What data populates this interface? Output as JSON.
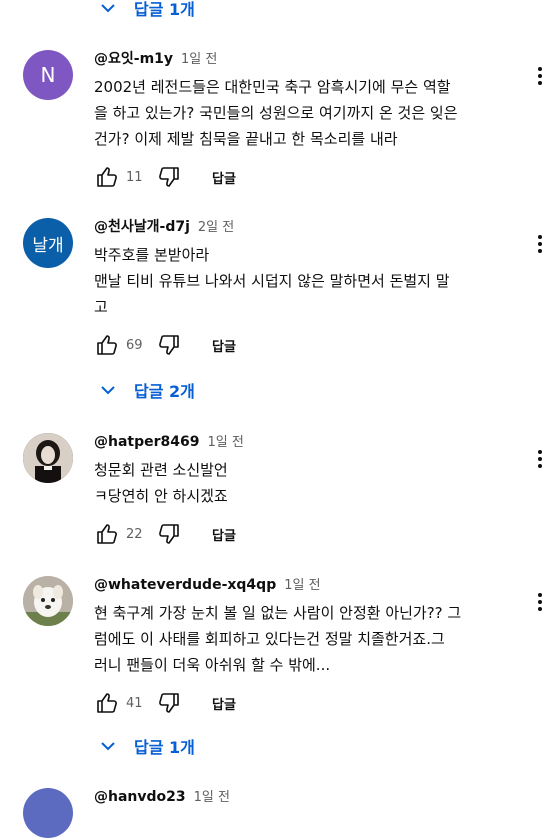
{
  "top_replies": {
    "label": "답글 1개"
  },
  "comments": [
    {
      "avatar_letter": "N",
      "avatar_color": "#7e57c2",
      "handle": "@요잇-m1y",
      "time": "1일 전",
      "text": "2002년 레전드들은 대한민국 축구 암흑시기에 무슨 역할\n을 하고 있는가? 국민들의 성원으로 여기까지 온 것은 잊은\n건가? 이제 제발 침묵을 끝내고 한 목소리를 내라",
      "likes": "11",
      "reply_label": "답글"
    },
    {
      "avatar_letter": "날개",
      "avatar_color": "#0b5ea8",
      "handle": "@천사날개-d7j",
      "time": "2일 전",
      "text": "박주호를 본받아라\n맨날 티비 유튜브 나와서 시덥지 않은 말하면서 돈벌지 말\n고",
      "likes": "69",
      "reply_label": "답글",
      "replies_label": "답글 2개"
    },
    {
      "handle": "@hatper8469",
      "time": "1일 전",
      "text": "청문회 관련 소신발언\nㅋ당연히 안 하시겠죠",
      "likes": "22",
      "reply_label": "답글"
    },
    {
      "handle": "@whateverdude-xq4qp",
      "time": "1일 전",
      "text": "현 축구계 가장 눈치 볼 일 없는 사람이 안정환 아닌가?? 그\n럼에도 이 사태를 회피하고 있다는건 정말 치졸한거죠.그\n러니 팬들이 더욱 아쉬워 할 수 밖에...",
      "likes": "41",
      "reply_label": "답글",
      "replies_label": "답글 1개"
    },
    {
      "handle": "@hanvdo23",
      "time": "1일 전"
    }
  ]
}
